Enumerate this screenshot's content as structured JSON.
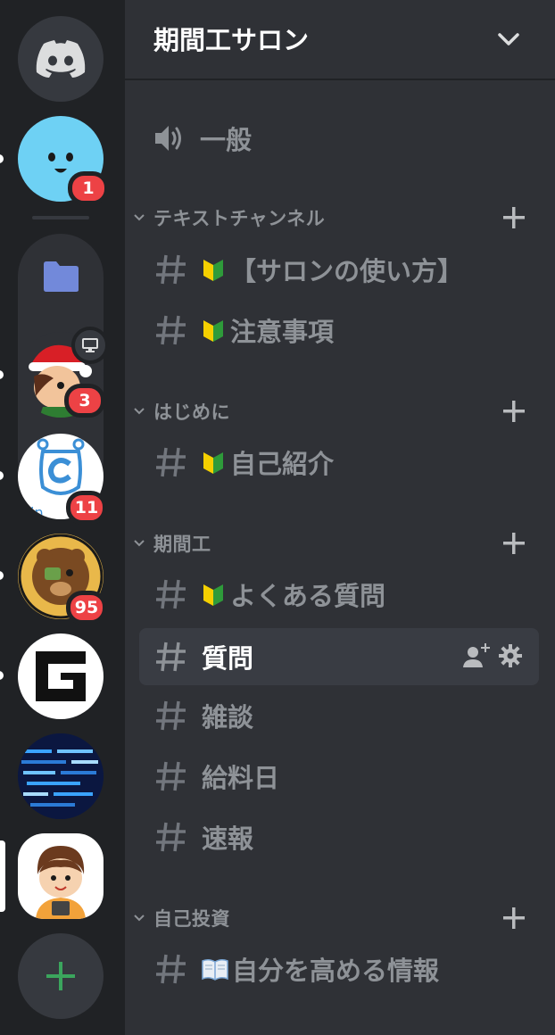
{
  "server_name": "期間工サロン",
  "rail": {
    "servers": [
      {
        "name": "discord-home"
      },
      {
        "name": "smiley-server",
        "badge": "1"
      },
      {
        "name": "folder"
      },
      {
        "name": "santa-server",
        "badge": "3"
      },
      {
        "name": "c-server",
        "badge": "11"
      },
      {
        "name": "bear-server",
        "badge": "95"
      },
      {
        "name": "g-server"
      },
      {
        "name": "code-server"
      },
      {
        "name": "boy-server"
      }
    ]
  },
  "voice_channel": {
    "label": "一般"
  },
  "categories": [
    {
      "label": "テキストチャンネル",
      "channels": [
        {
          "label": "【サロンの使い方】",
          "emoji": "beginner"
        },
        {
          "label": "注意事項",
          "emoji": "beginner"
        }
      ]
    },
    {
      "label": "はじめに",
      "channels": [
        {
          "label": "自己紹介",
          "emoji": "beginner"
        }
      ]
    },
    {
      "label": "期間工",
      "channels": [
        {
          "label": "よくある質問",
          "emoji": "beginner"
        },
        {
          "label": "質問",
          "active": true
        },
        {
          "label": "雑談"
        },
        {
          "label": "給料日"
        },
        {
          "label": "速報"
        }
      ]
    },
    {
      "label": "自己投資",
      "channels": [
        {
          "label": "自分を高める情報",
          "emoji": "book"
        }
      ]
    }
  ],
  "colors": {
    "rail_bg": "#202225",
    "panel_bg": "#2f3136",
    "active_bg": "#393c43",
    "muted_text": "#8e9297",
    "badge_red": "#ed4245",
    "blurple": "#7289da",
    "green_add": "#3ba55d"
  }
}
